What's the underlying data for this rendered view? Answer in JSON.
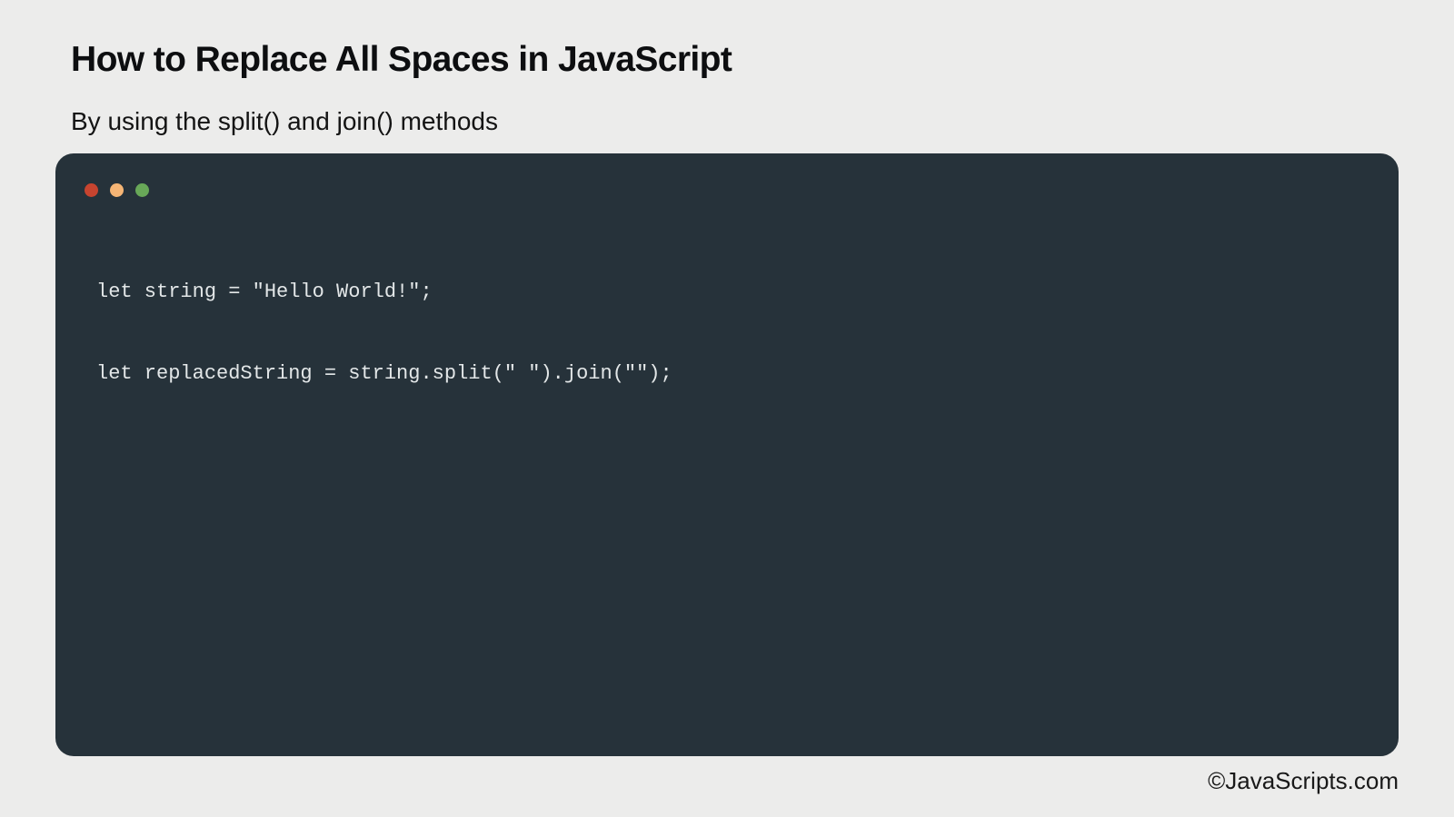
{
  "page": {
    "background_color": "#ECECEB",
    "title": "How to Replace All Spaces in JavaScript",
    "subtitle": "By using the split() and join() methods",
    "footer_credit": "©JavaScripts.com"
  },
  "code_window": {
    "background_color": "#26323A",
    "code_text_color": "#E3E7E8",
    "traffic_lights": [
      {
        "name": "close-dot",
        "color": "#C7442F"
      },
      {
        "name": "minimize-dot",
        "color": "#F5B575"
      },
      {
        "name": "zoom-dot",
        "color": "#68A858"
      }
    ],
    "code_lines": [
      "let string = \"Hello World!\";",
      "let replacedString = string.split(\" \").join(\"\");"
    ]
  }
}
